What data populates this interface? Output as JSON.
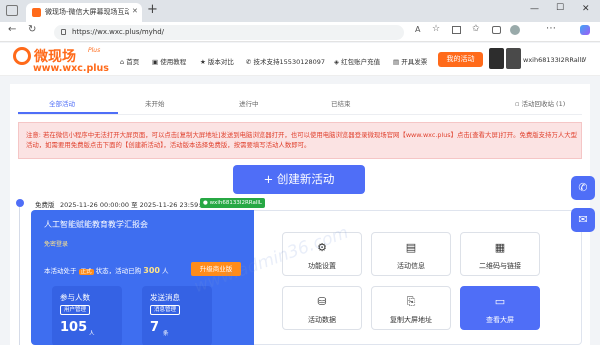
{
  "browser": {
    "tab_title": "微现场-微信大屏幕现场互动服务",
    "new_tab": "+",
    "url": "https://wx.wxc.plus/myhd/",
    "nav_back": "←",
    "nav_reload": "↻",
    "win_min": "—",
    "win_max": "☐",
    "win_close": "✕"
  },
  "header": {
    "logo_text": "微现场",
    "logo_plus": "Plus",
    "logo_domain": "www.wxc.plus",
    "nav": [
      {
        "icon": "⌂",
        "label": "首页"
      },
      {
        "icon": "▣",
        "label": "使用教程"
      },
      {
        "icon": "★",
        "label": "版本对比"
      },
      {
        "icon": "✆",
        "label": "技术支持15530128097"
      },
      {
        "icon": "◈",
        "label": "红包账户充值"
      },
      {
        "icon": "▤",
        "label": "开具发票"
      }
    ],
    "my_activity": "我的活动",
    "username": "wxih68133I2RRallL"
  },
  "tabs": [
    "全部活动",
    "未开始",
    "进行中",
    "已结束"
  ],
  "recycle_label": "活动回收站 (1)",
  "notice": "注意: 若在微信小程序中无法打开大屏页面，可以点击[复制大屏地址]发送到电脑浏览器打开，也可以使用电脑浏览器登录微现场官网【www.wxc.plus】点击[查看大屏]打开。免费版支持万人大型活动，如需要用免费版点击下面的【创建新活动】，活动版本选择免费版，按需要填写活动人数即可。",
  "create_button": "+ 创建新活动",
  "activity": {
    "version": "免费版",
    "time_range": "2025-11-26 00:00:00 至 2025-11-26 23:59:59",
    "owner_badge": "wxih68133I2RRallL",
    "title": "人工智能赋能教育教学汇报会",
    "login_type": "免密登录",
    "status_prefix": "本活动处于",
    "status": "正式",
    "status_mid": "状态，活动已购",
    "capacity": "300",
    "capacity_unit": "人",
    "upgrade": "升级商业版",
    "stats": [
      {
        "label": "参与人数",
        "sub": "用户管理",
        "value": "105",
        "unit": "人"
      },
      {
        "label": "发送消息",
        "sub": "消息管理",
        "value": "7",
        "unit": "条"
      }
    ],
    "actions": [
      {
        "icon": "⚙",
        "label": "功能设置"
      },
      {
        "icon": "▤",
        "label": "活动信息"
      },
      {
        "icon": "▦",
        "label": "二维码与链接"
      },
      {
        "icon": "⛁",
        "label": "活动数据"
      },
      {
        "icon": "⎘",
        "label": "复制大屏地址"
      },
      {
        "icon": "▭",
        "label": "查看大屏"
      }
    ]
  },
  "watermark": "www.admin36.com",
  "colors": {
    "accent": "#4f6ef7",
    "brand_orange": "#ff6a1a",
    "notice_red": "#e0412e",
    "panel_blue": "#3e6ef0"
  }
}
